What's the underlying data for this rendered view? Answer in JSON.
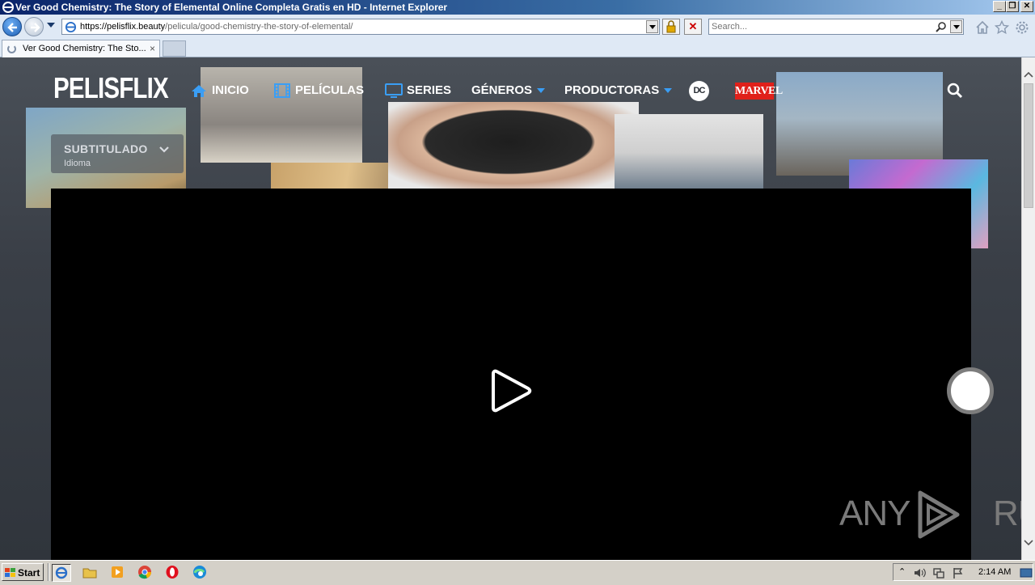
{
  "browser": {
    "window_title": "Ver Good Chemistry: The Story of Elemental Online Completa Gratis en HD - Internet Explorer",
    "url_host": "https://pelisflix.beauty",
    "url_path": "/pelicula/good-chemistry-the-story-of-elemental/",
    "search_placeholder": "Search...",
    "tab_title": "Ver Good Chemistry: The Sto...",
    "tab_close": "×"
  },
  "site": {
    "logo": "PELISFLIX",
    "menu": [
      {
        "label": "INICIO",
        "icon": "home-icon"
      },
      {
        "label": "PELÍCULAS",
        "icon": "film-icon"
      },
      {
        "label": "SERIES",
        "icon": "tv-icon"
      },
      {
        "label": "GÉNEROS",
        "icon": "caret-down-icon"
      },
      {
        "label": "PRODUCTORAS",
        "icon": "caret-down-icon"
      }
    ],
    "dc_logo": "DC",
    "marvel_logo": "MARVEL",
    "language": {
      "selected": "SUBTITULADO",
      "caption": "Idioma"
    },
    "watermark_left": "ANY",
    "watermark_right": "RUN"
  },
  "taskbar": {
    "start_label": "Start",
    "clock": "2:14 AM"
  },
  "colors": {
    "accent_blue": "#3a9ef5",
    "marvel_red": "#e0201a",
    "player_bg": "#000000"
  }
}
